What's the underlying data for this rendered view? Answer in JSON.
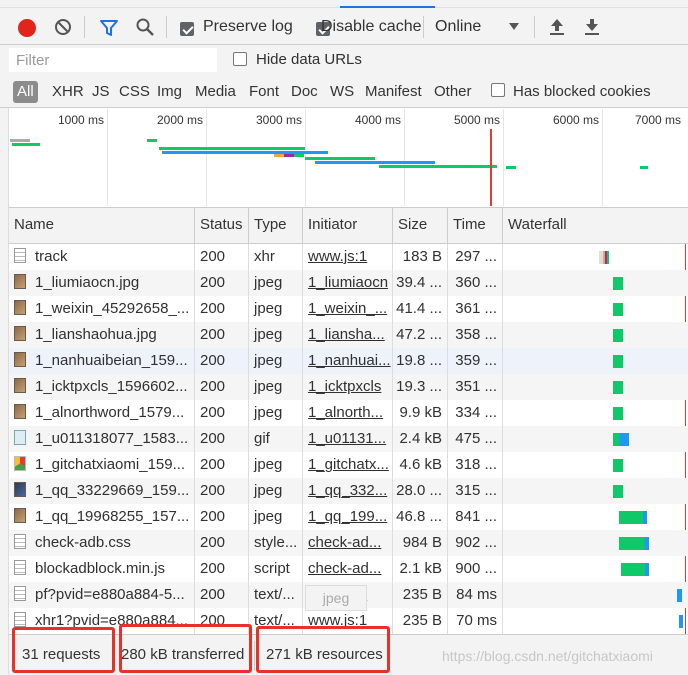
{
  "toolbar": {
    "preserve_log_label": "Preserve log",
    "preserve_log_checked": true,
    "disable_cache_label": "Disable cache",
    "disable_cache_checked": true,
    "throttling_value": "Online",
    "record_icon": "record-icon",
    "clear_icon": "clear-icon",
    "filter_icon": "filter-icon",
    "search_icon": "search-icon",
    "import_icon": "upload-arrow-icon",
    "export_icon": "download-arrow-icon"
  },
  "filterbar": {
    "placeholder": "Filter",
    "hide_data_urls_label": "Hide data URLs",
    "hide_data_urls_checked": false
  },
  "typebar": {
    "types": [
      "All",
      "XHR",
      "JS",
      "CSS",
      "Img",
      "Media",
      "Font",
      "Doc",
      "WS",
      "Manifest",
      "Other"
    ],
    "active": "All",
    "has_blocked_cookies_label": "Has blocked cookies",
    "has_blocked_cookies_checked": false
  },
  "overview": {
    "ticks": [
      "1000 ms",
      "2000 ms",
      "3000 ms",
      "4000 ms",
      "5000 ms",
      "6000 ms",
      "7000 ms"
    ]
  },
  "columns": {
    "name": "Name",
    "status": "Status",
    "type": "Type",
    "initiator": "Initiator",
    "size": "Size",
    "time": "Time",
    "waterfall": "Waterfall"
  },
  "rows": [
    {
      "name": "track",
      "status": "200",
      "type": "xhr",
      "initiator": "www.js:1",
      "size": "183 B",
      "time": "297 ...",
      "icon": "document-icon"
    },
    {
      "name": "1_liumiaocn.jpg",
      "status": "200",
      "type": "jpeg",
      "initiator": "1_liumiaocn",
      "size": "39.4 ...",
      "time": "360 ...",
      "icon": "image-icon"
    },
    {
      "name": "1_weixin_45292658_...",
      "status": "200",
      "type": "jpeg",
      "initiator": "1_weixin_...",
      "size": "41.4 ...",
      "time": "361 ...",
      "icon": "image-icon"
    },
    {
      "name": "1_lianshaohua.jpg",
      "status": "200",
      "type": "jpeg",
      "initiator": "1_liansha...",
      "size": "47.2 ...",
      "time": "358 ...",
      "icon": "image-icon"
    },
    {
      "name": "1_nanhuaibeian_159...",
      "status": "200",
      "type": "jpeg",
      "initiator": "1_nanhuai...",
      "size": "19.8 ...",
      "time": "359 ...",
      "icon": "image-icon"
    },
    {
      "name": "1_icktpxcls_1596602...",
      "status": "200",
      "type": "jpeg",
      "initiator": "1_icktpxcls",
      "size": "19.3 ...",
      "time": "351 ...",
      "icon": "image-icon"
    },
    {
      "name": "1_alnorthword_1579...",
      "status": "200",
      "type": "jpeg",
      "initiator": "1_alnorth...",
      "size": "9.9 kB",
      "time": "334 ...",
      "icon": "image-icon"
    },
    {
      "name": "1_u011318077_1583...",
      "status": "200",
      "type": "gif",
      "initiator": "1_u01131...",
      "size": "2.4 kB",
      "time": "475 ...",
      "icon": "gif-icon"
    },
    {
      "name": "1_gitchatxiaomi_159...",
      "status": "200",
      "type": "jpeg",
      "initiator": "1_gitchatx...",
      "size": "4.6 kB",
      "time": "318 ...",
      "icon": "image-icon"
    },
    {
      "name": "1_qq_33229669_159...",
      "status": "200",
      "type": "jpeg",
      "initiator": "1_qq_332...",
      "size": "28.0 ...",
      "time": "315 ...",
      "icon": "image-icon"
    },
    {
      "name": "1_qq_19968255_157...",
      "status": "200",
      "type": "jpeg",
      "initiator": "1_qq_199...",
      "size": "46.8 ...",
      "time": "841 ...",
      "icon": "image-icon"
    },
    {
      "name": "check-adb.css",
      "status": "200",
      "type": "style...",
      "initiator": "check-ad...",
      "size": "984 B",
      "time": "902 ...",
      "icon": "stylesheet-icon"
    },
    {
      "name": "blockadblock.min.js",
      "status": "200",
      "type": "script",
      "initiator": "check-ad...",
      "size": "2.1 kB",
      "time": "900 ...",
      "icon": "script-icon"
    },
    {
      "name": "pf?pvid=e880a884-5...",
      "status": "200",
      "type": "text/...",
      "initiator": "www.js:1",
      "size": "235 B",
      "time": "84 ms",
      "icon": "document-icon"
    },
    {
      "name": "xhr1?pvid=e880a884...",
      "status": "200",
      "type": "text/...",
      "initiator": "www.js:1",
      "size": "235 B",
      "time": "70 ms",
      "icon": "document-icon"
    }
  ],
  "tooltip": "jpeg",
  "status": {
    "requests": "31 requests",
    "transferred": "280 kB transferred",
    "resources": "271 kB resources"
  },
  "watermark": "https://blog.csdn.net/gitchatxiaomi",
  "colors": {
    "record_red": "#e1251b",
    "active_blue": "#1a73e8",
    "waterfall_green": "#0fc867",
    "waterfall_blue": "#2196f3",
    "annotation_red": "#e8312b",
    "load_line_red": "#e53935"
  }
}
